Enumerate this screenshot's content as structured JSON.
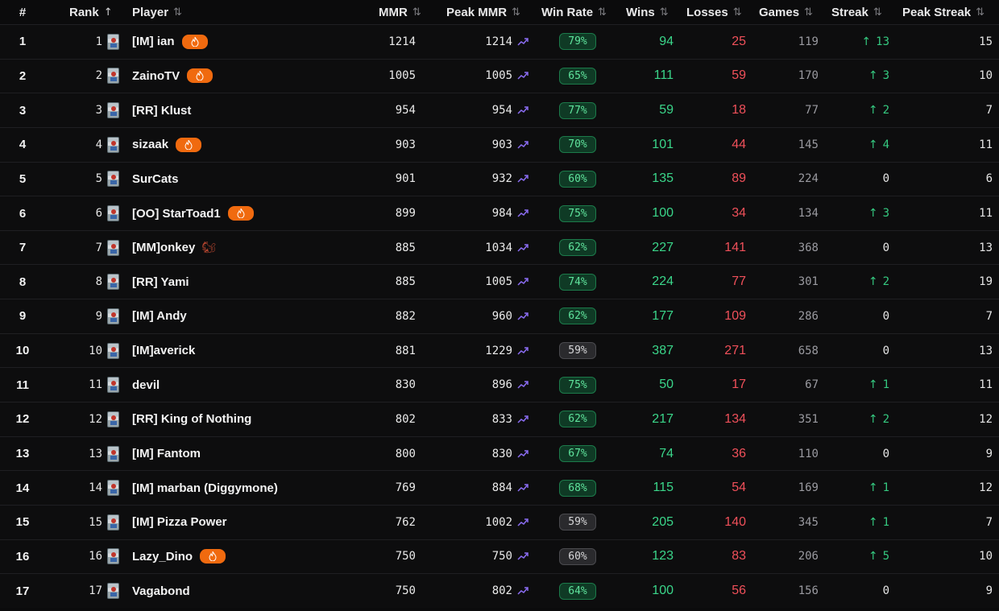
{
  "headers": {
    "num": "#",
    "rank": "Rank",
    "player": "Player",
    "mmr": "MMR",
    "peak_mmr": "Peak MMR",
    "win_rate": "Win Rate",
    "wins": "Wins",
    "losses": "Losses",
    "games": "Games",
    "streak": "Streak",
    "peak_streak": "Peak Streak"
  },
  "sort_icons": {
    "active": "arrow-up-icon",
    "inactive": "sort-updown-icon"
  },
  "colors": {
    "wins": "#3ad68a",
    "losses": "#f0505a",
    "fire_badge": "#f06a0f",
    "streak_up": "#35c980",
    "trend": "#8a6cf0"
  },
  "rows": [
    {
      "num": "1",
      "rank": "1",
      "player": "[IM] ian",
      "badge": "fire",
      "mmr": "1214",
      "peak": "1214",
      "wr": "79%",
      "wr_style": "green",
      "wins": "94",
      "losses": "25",
      "games": "119",
      "streak": "13",
      "streak_up": true,
      "peak_streak": "15"
    },
    {
      "num": "2",
      "rank": "2",
      "player": "ZainoTV",
      "badge": "fire",
      "mmr": "1005",
      "peak": "1005",
      "wr": "65%",
      "wr_style": "green",
      "wins": "111",
      "losses": "59",
      "games": "170",
      "streak": "3",
      "streak_up": true,
      "peak_streak": "10"
    },
    {
      "num": "3",
      "rank": "3",
      "player": "[RR] Klust",
      "badge": "",
      "mmr": "954",
      "peak": "954",
      "wr": "77%",
      "wr_style": "green",
      "wins": "59",
      "losses": "18",
      "games": "77",
      "streak": "2",
      "streak_up": true,
      "peak_streak": "7"
    },
    {
      "num": "4",
      "rank": "4",
      "player": "sizaak",
      "badge": "fire",
      "mmr": "903",
      "peak": "903",
      "wr": "70%",
      "wr_style": "green",
      "wins": "101",
      "losses": "44",
      "games": "145",
      "streak": "4",
      "streak_up": true,
      "peak_streak": "11"
    },
    {
      "num": "5",
      "rank": "5",
      "player": "SurCats",
      "badge": "",
      "mmr": "901",
      "peak": "932",
      "wr": "60%",
      "wr_style": "green",
      "wins": "135",
      "losses": "89",
      "games": "224",
      "streak": "0",
      "streak_up": false,
      "peak_streak": "6"
    },
    {
      "num": "6",
      "rank": "6",
      "player": "[OO] StarToad1",
      "badge": "fire",
      "mmr": "899",
      "peak": "984",
      "wr": "75%",
      "wr_style": "green",
      "wins": "100",
      "losses": "34",
      "games": "134",
      "streak": "3",
      "streak_up": true,
      "peak_streak": "11"
    },
    {
      "num": "7",
      "rank": "7",
      "player": "[MM]onkey",
      "badge": "squirrel",
      "mmr": "885",
      "peak": "1034",
      "wr": "62%",
      "wr_style": "green",
      "wins": "227",
      "losses": "141",
      "games": "368",
      "streak": "0",
      "streak_up": false,
      "peak_streak": "13"
    },
    {
      "num": "8",
      "rank": "8",
      "player": "[RR] Yami",
      "badge": "",
      "mmr": "885",
      "peak": "1005",
      "wr": "74%",
      "wr_style": "green",
      "wins": "224",
      "losses": "77",
      "games": "301",
      "streak": "2",
      "streak_up": true,
      "peak_streak": "19"
    },
    {
      "num": "9",
      "rank": "9",
      "player": "[IM] Andy",
      "badge": "",
      "mmr": "882",
      "peak": "960",
      "wr": "62%",
      "wr_style": "green",
      "wins": "177",
      "losses": "109",
      "games": "286",
      "streak": "0",
      "streak_up": false,
      "peak_streak": "7"
    },
    {
      "num": "10",
      "rank": "10",
      "player": "[IM]averick",
      "badge": "",
      "mmr": "881",
      "peak": "1229",
      "wr": "59%",
      "wr_style": "gray",
      "wins": "387",
      "losses": "271",
      "games": "658",
      "streak": "0",
      "streak_up": false,
      "peak_streak": "13"
    },
    {
      "num": "11",
      "rank": "11",
      "player": "devil",
      "badge": "",
      "mmr": "830",
      "peak": "896",
      "wr": "75%",
      "wr_style": "green",
      "wins": "50",
      "losses": "17",
      "games": "67",
      "streak": "1",
      "streak_up": true,
      "peak_streak": "11"
    },
    {
      "num": "12",
      "rank": "12",
      "player": "[RR] King of Nothing",
      "badge": "",
      "mmr": "802",
      "peak": "833",
      "wr": "62%",
      "wr_style": "green",
      "wins": "217",
      "losses": "134",
      "games": "351",
      "streak": "2",
      "streak_up": true,
      "peak_streak": "12"
    },
    {
      "num": "13",
      "rank": "13",
      "player": "[IM] Fantom",
      "badge": "",
      "mmr": "800",
      "peak": "830",
      "wr": "67%",
      "wr_style": "green",
      "wins": "74",
      "losses": "36",
      "games": "110",
      "streak": "0",
      "streak_up": false,
      "peak_streak": "9"
    },
    {
      "num": "14",
      "rank": "14",
      "player": "[IM] marban (Diggymone)",
      "badge": "",
      "mmr": "769",
      "peak": "884",
      "wr": "68%",
      "wr_style": "green",
      "wins": "115",
      "losses": "54",
      "games": "169",
      "streak": "1",
      "streak_up": true,
      "peak_streak": "12"
    },
    {
      "num": "15",
      "rank": "15",
      "player": "[IM] Pizza Power",
      "badge": "",
      "mmr": "762",
      "peak": "1002",
      "wr": "59%",
      "wr_style": "gray",
      "wins": "205",
      "losses": "140",
      "games": "345",
      "streak": "1",
      "streak_up": true,
      "peak_streak": "7"
    },
    {
      "num": "16",
      "rank": "16",
      "player": "Lazy_Dino",
      "badge": "fire",
      "mmr": "750",
      "peak": "750",
      "wr": "60%",
      "wr_style": "gray",
      "wins": "123",
      "losses": "83",
      "games": "206",
      "streak": "5",
      "streak_up": true,
      "peak_streak": "10"
    },
    {
      "num": "17",
      "rank": "17",
      "player": "Vagabond",
      "badge": "",
      "mmr": "750",
      "peak": "802",
      "wr": "64%",
      "wr_style": "green",
      "wins": "100",
      "losses": "56",
      "games": "156",
      "streak": "0",
      "streak_up": false,
      "peak_streak": "9"
    }
  ]
}
